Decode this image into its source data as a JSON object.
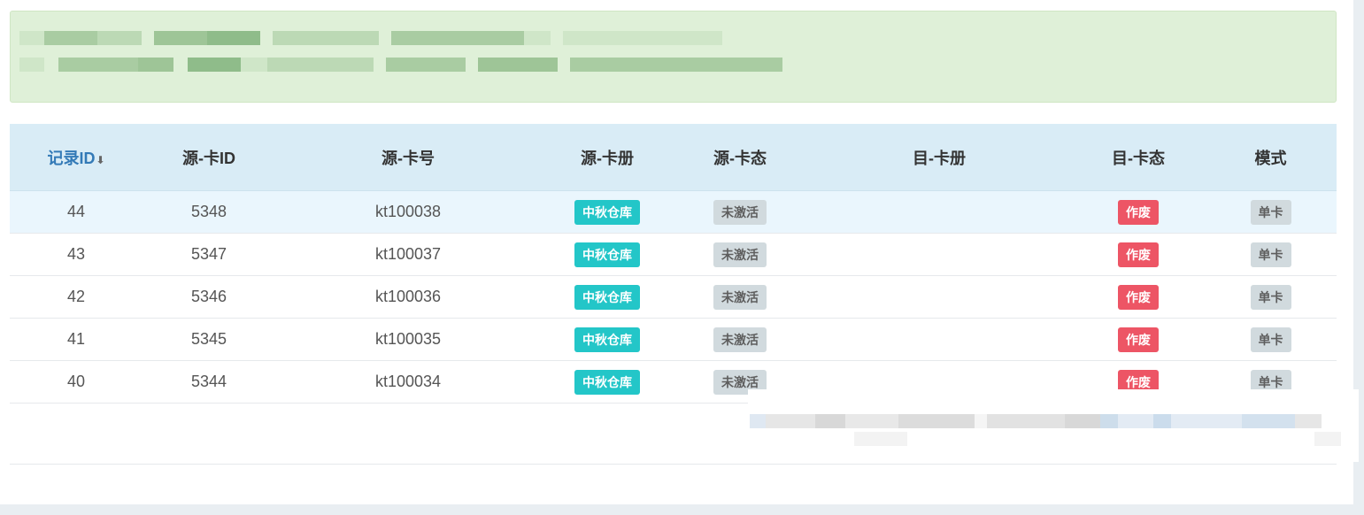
{
  "alert": {
    "pixelated": true,
    "colors": [
      "#8fbc8a",
      "#a9cca2",
      "#bcd9b5",
      "#cfe6c8",
      "#9ec597"
    ]
  },
  "table": {
    "headers": {
      "record_id": "记录ID",
      "src_card_id": "源-卡ID",
      "src_card_no": "源-卡号",
      "src_register": "源-卡册",
      "src_status": "源-卡态",
      "dst_register": "目-卡册",
      "dst_status": "目-卡态",
      "mode": "模式"
    },
    "sort_icon": "arrow-down-icon",
    "sort_arrow": "⬇",
    "rows": [
      {
        "record_id": "44",
        "src_card_id": "5348",
        "src_card_no": "kt100038",
        "src_register": "中秋仓库",
        "src_status": "未激活",
        "dst_register": "",
        "dst_status": "作废",
        "mode": "单卡"
      },
      {
        "record_id": "43",
        "src_card_id": "5347",
        "src_card_no": "kt100037",
        "src_register": "中秋仓库",
        "src_status": "未激活",
        "dst_register": "",
        "dst_status": "作废",
        "mode": "单卡"
      },
      {
        "record_id": "42",
        "src_card_id": "5346",
        "src_card_no": "kt100036",
        "src_register": "中秋仓库",
        "src_status": "未激活",
        "dst_register": "",
        "dst_status": "作废",
        "mode": "单卡"
      },
      {
        "record_id": "41",
        "src_card_id": "5345",
        "src_card_no": "kt100035",
        "src_register": "中秋仓库",
        "src_status": "未激活",
        "dst_register": "",
        "dst_status": "作废",
        "mode": "单卡"
      },
      {
        "record_id": "40",
        "src_card_id": "5344",
        "src_card_no": "kt100034",
        "src_register": "中秋仓库",
        "src_status": "未激活",
        "dst_register": "",
        "dst_status": "作废",
        "mode": "单卡"
      }
    ]
  },
  "colors": {
    "header_bg": "#d9ecf6",
    "highlight_row": "#eaf6fd",
    "teal_badge": "#23c6c8",
    "gray_badge": "#d1dade",
    "red_badge": "#ed5565",
    "sort_link": "#337ab7"
  },
  "pager": {
    "pixelated": true
  }
}
